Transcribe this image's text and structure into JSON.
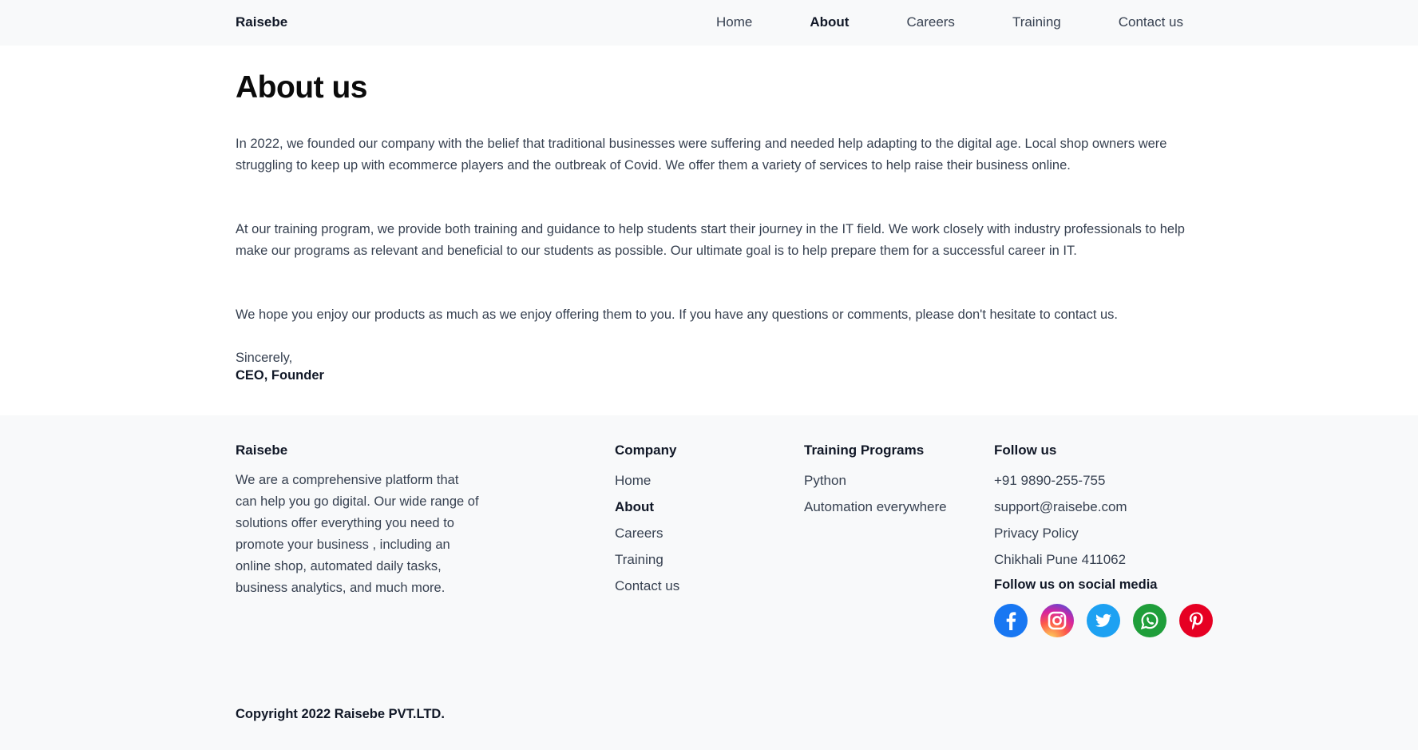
{
  "header": {
    "brand": "Raisebe",
    "nav": [
      "Home",
      "About",
      "Careers",
      "Training",
      "Contact us"
    ],
    "active_nav": "About"
  },
  "main": {
    "title": "About us",
    "paragraphs": [
      "In 2022, we founded our company with the belief that traditional businesses were suffering and needed help adapting to the digital age. Local shop owners were struggling to keep up with ecommerce players and the outbreak of Covid. We offer them a variety of services to help raise their business online.",
      "At our training program, we provide both training and guidance to help students start their journey in the IT field. We work closely with industry professionals to help make our programs as relevant and beneficial to our students as possible. Our ultimate goal is to help prepare them for a successful career in IT.",
      "We hope you enjoy our products as much as we enjoy offering them to you. If you have any questions or comments, please don't hesitate to contact us."
    ],
    "sincerely": "Sincerely,",
    "signoff": "CEO, Founder"
  },
  "footer": {
    "brand": "Raisebe",
    "description": "We are a comprehensive platform that can help you go digital. Our wide range of solutions offer everything you need to promote your business , including an online shop, automated daily tasks, business analytics, and much more.",
    "company": {
      "heading": "Company",
      "links": [
        "Home",
        "About",
        "Careers",
        "Training",
        "Contact us"
      ]
    },
    "training": {
      "heading": "Training Programs",
      "links": [
        "Python",
        "Automation everywhere"
      ]
    },
    "follow": {
      "heading": "Follow us",
      "items": [
        "+91 9890-255-755",
        "support@raisebe.com",
        "Privacy Policy",
        "Chikhali Pune 411062"
      ],
      "social_heading": "Follow us on social media",
      "social_icons": [
        "facebook-icon",
        "instagram-icon",
        "twitter-icon",
        "whatsapp-icon",
        "pinterest-icon"
      ]
    },
    "copyright": "Copyright 2022 Raisebe PVT.LTD."
  },
  "colors": {
    "background": "#ffffff",
    "header_footer_bg": "#f8f9fa",
    "text": "#374151",
    "heading": "#111827",
    "facebook": "#1877f2",
    "twitter": "#1da1f2",
    "whatsapp": "#1f9e3a",
    "pinterest": "#e60023"
  }
}
